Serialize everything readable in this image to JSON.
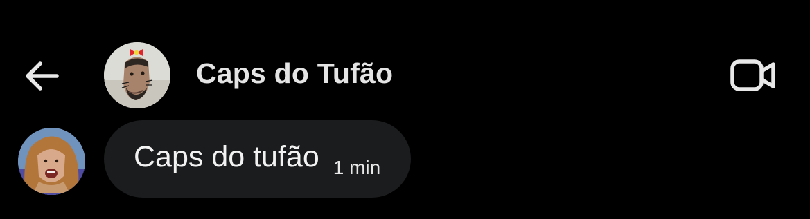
{
  "header": {
    "back_icon": "arrow-left-icon",
    "contact_name": "Caps do Tufão",
    "contact_avatar_icon": "user-avatar-icon",
    "video_icon": "video-camera-icon"
  },
  "messages": [
    {
      "text": "Caps do tufão",
      "time": "1 min",
      "sender_avatar_icon": "user-avatar-icon"
    }
  ],
  "colors": {
    "background": "#000000",
    "bubble": "#1b1c1e",
    "text": "#f2f2f2",
    "header_text": "#e4e4e4"
  }
}
